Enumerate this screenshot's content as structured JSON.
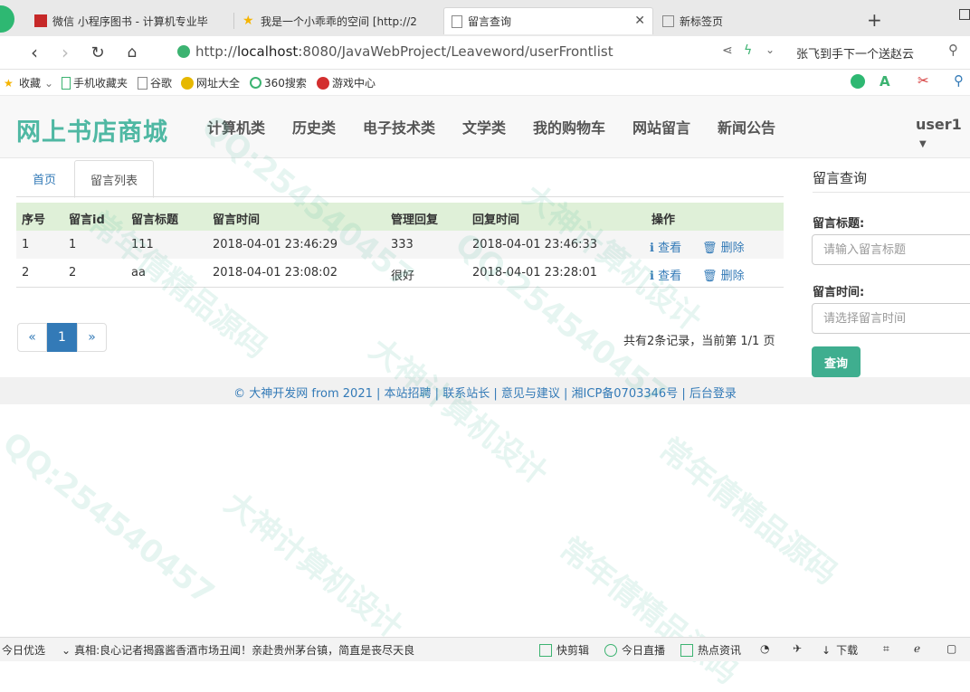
{
  "browser": {
    "tabs": [
      {
        "title": "微信 小程序图书 - 计算机专业毕"
      },
      {
        "title": "我是一个小乖乖的空间 [http://2"
      },
      {
        "title": "留言查询"
      },
      {
        "title": "新标签页"
      }
    ],
    "url_prefix": "http://",
    "url_host": "localhost",
    "url_rest": ":8080/JavaWebProject/Leaveword/userFrontlist",
    "search_hint": "张飞到手下一个送赵云",
    "bookmarks": [
      "收藏",
      "手机收藏夹",
      "谷歌",
      "网址大全",
      "360搜索",
      "游戏中心"
    ]
  },
  "site": {
    "brand": "网上书店商城",
    "nav": [
      "计算机类",
      "历史类",
      "电子技术类",
      "文学类",
      "我的购物车",
      "网站留言",
      "新闻公告"
    ],
    "user": "user1"
  },
  "content_tabs": [
    "首页",
    "留言列表"
  ],
  "table": {
    "headers": [
      "序号",
      "留言id",
      "留言标题",
      "留言时间",
      "管理回复",
      "回复时间",
      "操作"
    ],
    "rows": [
      {
        "no": "1",
        "id": "1",
        "title": "111",
        "time": "2018-04-01 23:46:29",
        "reply": "333",
        "reply_time": "2018-04-01 23:46:33",
        "view": "查看",
        "del": "删除"
      },
      {
        "no": "2",
        "id": "2",
        "title": "aa",
        "time": "2018-04-01 23:08:02",
        "reply": "很好",
        "reply_time": "2018-04-01 23:28:01",
        "view": "查看",
        "del": "删除"
      }
    ]
  },
  "pagination": {
    "prev": "«",
    "current": "1",
    "next": "»",
    "summary": "共有2条记录，当前第 1/1 页"
  },
  "sidebar": {
    "title": "留言查询",
    "title_label": "留言标题:",
    "title_placeholder": "请输入留言标题",
    "time_label": "留言时间:",
    "time_placeholder": "请选择留言时间",
    "button": "查询"
  },
  "footer": {
    "copyright": "© 大神开发网 from 2021",
    "links": [
      "本站招聘",
      "联系站长",
      "意见与建议",
      "湘ICP备0703346号",
      "后台登录"
    ]
  },
  "statusbar": {
    "left": "今日优选",
    "news": "真相:良心记者揭露酱香酒市场丑闻！亲赴贵州茅台镇，简直是丧尽天良",
    "items": [
      "快剪辑",
      "今日直播",
      "热点资讯",
      "下载"
    ]
  },
  "watermarks": [
    "QQ:254540457",
    "大神计算机设计",
    "常年倩精品源码"
  ],
  "colors": {
    "brand": "#4fb8a3",
    "link": "#337ab7",
    "table_head": "#dff0d8",
    "button": "#3fae8f"
  }
}
